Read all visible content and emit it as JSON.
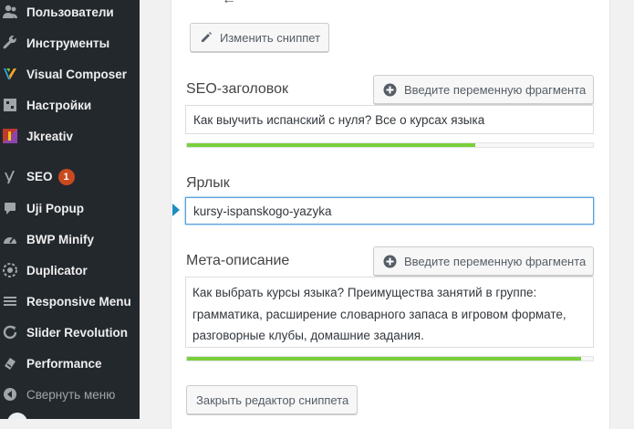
{
  "sidebar": {
    "items": [
      {
        "label": "Пользователи",
        "icon": "users-icon",
        "badge": ""
      },
      {
        "label": "Инструменты",
        "icon": "wrench-icon",
        "badge": ""
      },
      {
        "label": "Visual Composer",
        "icon": "visual-composer-icon",
        "badge": ""
      },
      {
        "label": "Настройки",
        "icon": "settings-icon",
        "badge": ""
      },
      {
        "label": "Jkreativ",
        "icon": "jkreativ-icon",
        "badge": ""
      },
      {
        "label": "SEO",
        "icon": "yoast-seo-icon",
        "badge": "1"
      },
      {
        "label": "Uji Popup",
        "icon": "speech-bubble-icon",
        "badge": ""
      },
      {
        "label": "BWP Minify",
        "icon": "gauge-icon",
        "badge": ""
      },
      {
        "label": "Duplicator",
        "icon": "duplicator-icon",
        "badge": ""
      },
      {
        "label": "Responsive Menu",
        "icon": "hamburger-menu-icon",
        "badge": ""
      },
      {
        "label": "Slider Revolution",
        "icon": "refresh-icon",
        "badge": ""
      },
      {
        "label": "Performance",
        "icon": "performance-icon",
        "badge": ""
      }
    ],
    "collapse_label": "Свернуть меню"
  },
  "snippet_editor": {
    "edit_button_label": "Изменить сниппет",
    "variable_button_label": "Введите переменную фрагмента",
    "seo_title": {
      "label": "SEO-заголовок",
      "value": "Как выучить испанский с нуля? Все о курсах языка",
      "progress": 0.71
    },
    "slug": {
      "label": "Ярлык",
      "value": "kursy-ispanskogo-yazyka"
    },
    "meta_description": {
      "label": "Мета-описание",
      "lines": [
        "Как выбрать курсы языка? Преимущества занятий в группе:",
        "грамматика, расширение словарного запаса в игровом формате,",
        "разговорные клубы, домашние задания."
      ],
      "progress": 0.97
    },
    "close_button_label": "Закрыть редактор сниппета"
  },
  "colors": {
    "sidebar_bg": "#23282d",
    "progress_green": "#7ad03a",
    "focus_blue": "#5b9dd9",
    "badge_red": "#ca4a1f"
  }
}
